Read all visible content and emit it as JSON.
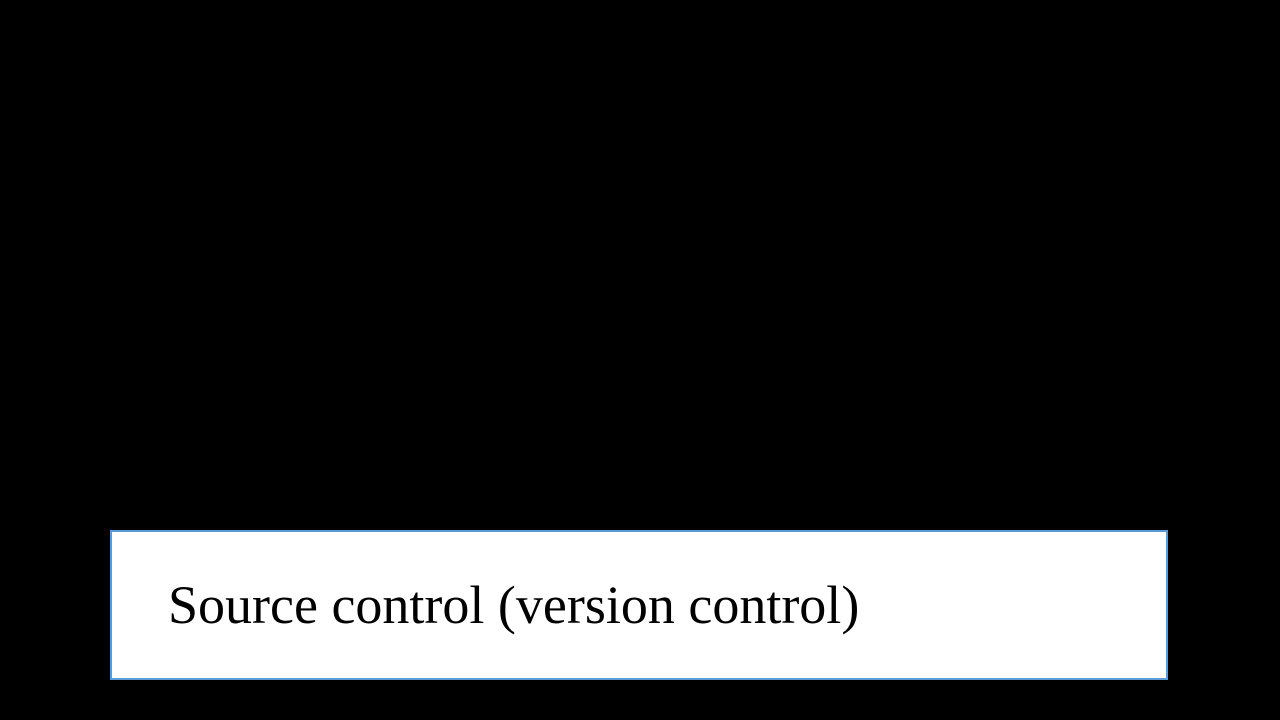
{
  "caption": {
    "text": "Source control (version control)",
    "border_color": "#5b9bd5",
    "background_color": "#ffffff"
  }
}
